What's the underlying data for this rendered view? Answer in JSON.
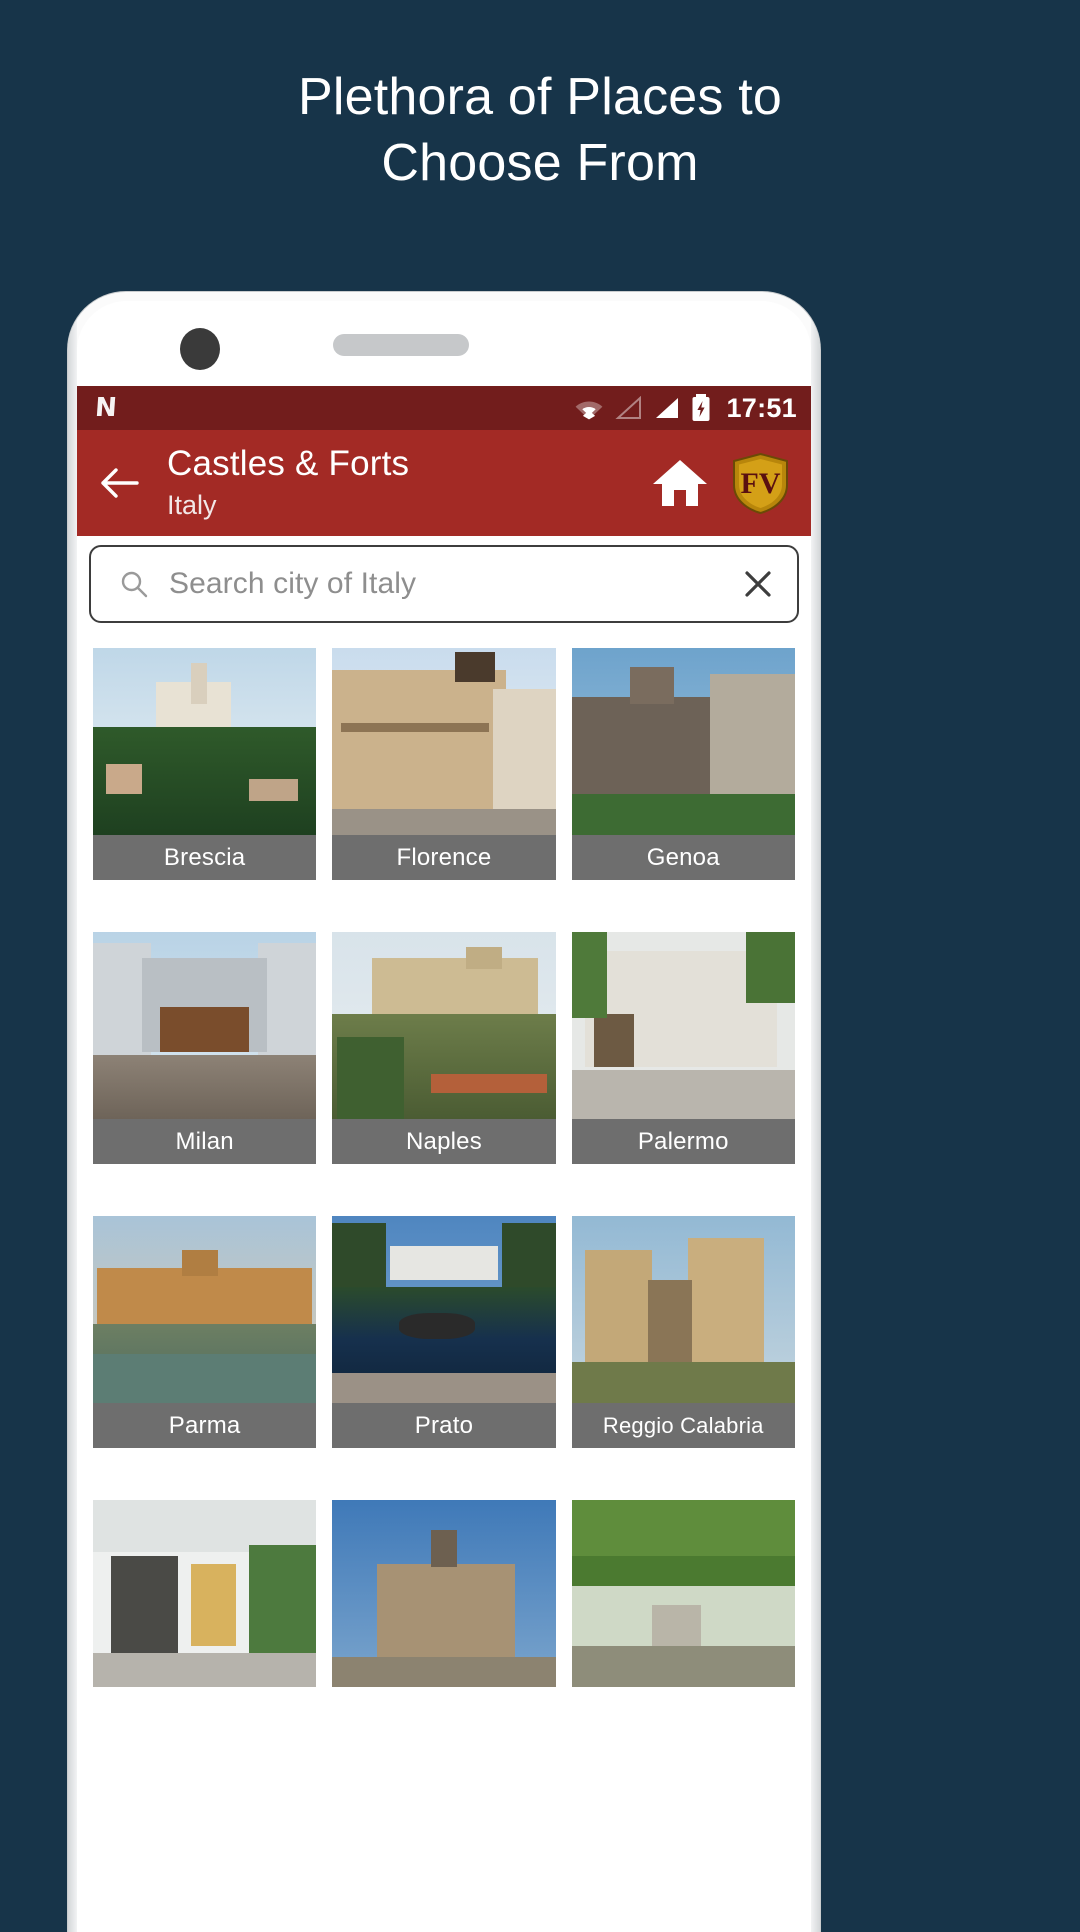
{
  "promo": {
    "headline_line1": "Plethora of Places to",
    "headline_line2": "Choose From",
    "background_color": "#173449"
  },
  "status_bar": {
    "nav_icon": "nav-app-icon",
    "nav_glyph": "N",
    "wifi_icon": "wifi-icon",
    "signal_empty_icon": "signal-empty-icon",
    "signal_full_icon": "signal-full-icon",
    "battery_icon": "battery-charging-icon",
    "clock": "17:51",
    "background_color": "#721d1c"
  },
  "app_bar": {
    "back_icon": "back-arrow-icon",
    "title": "Castles & Forts",
    "subtitle": "Italy",
    "home_icon": "home-icon",
    "logo_icon": "shield-logo-icon",
    "logo_text": "FV",
    "background_color": "#a32a25"
  },
  "search": {
    "icon": "search-icon",
    "placeholder": "Search city of Italy",
    "value": "",
    "clear_icon": "clear-icon"
  },
  "grid": {
    "cards": [
      {
        "label": "Brescia",
        "image": "brescia-castle-photo"
      },
      {
        "label": "Florence",
        "image": "florence-palace-photo"
      },
      {
        "label": "Genoa",
        "image": "genoa-castle-photo"
      },
      {
        "label": "Milan",
        "image": "milan-courtyard-photo"
      },
      {
        "label": "Naples",
        "image": "naples-fort-photo"
      },
      {
        "label": "Palermo",
        "image": "palermo-street-photo"
      },
      {
        "label": "Parma",
        "image": "parma-palace-photo"
      },
      {
        "label": "Prato",
        "image": "prato-villa-photo"
      },
      {
        "label": "Reggio Calabria",
        "image": "reggio-calabria-ruins-photo"
      },
      {
        "label": "",
        "image": "interior-hall-photo"
      },
      {
        "label": "",
        "image": "stone-fort-photo"
      },
      {
        "label": "",
        "image": "garden-pergola-photo"
      }
    ]
  }
}
